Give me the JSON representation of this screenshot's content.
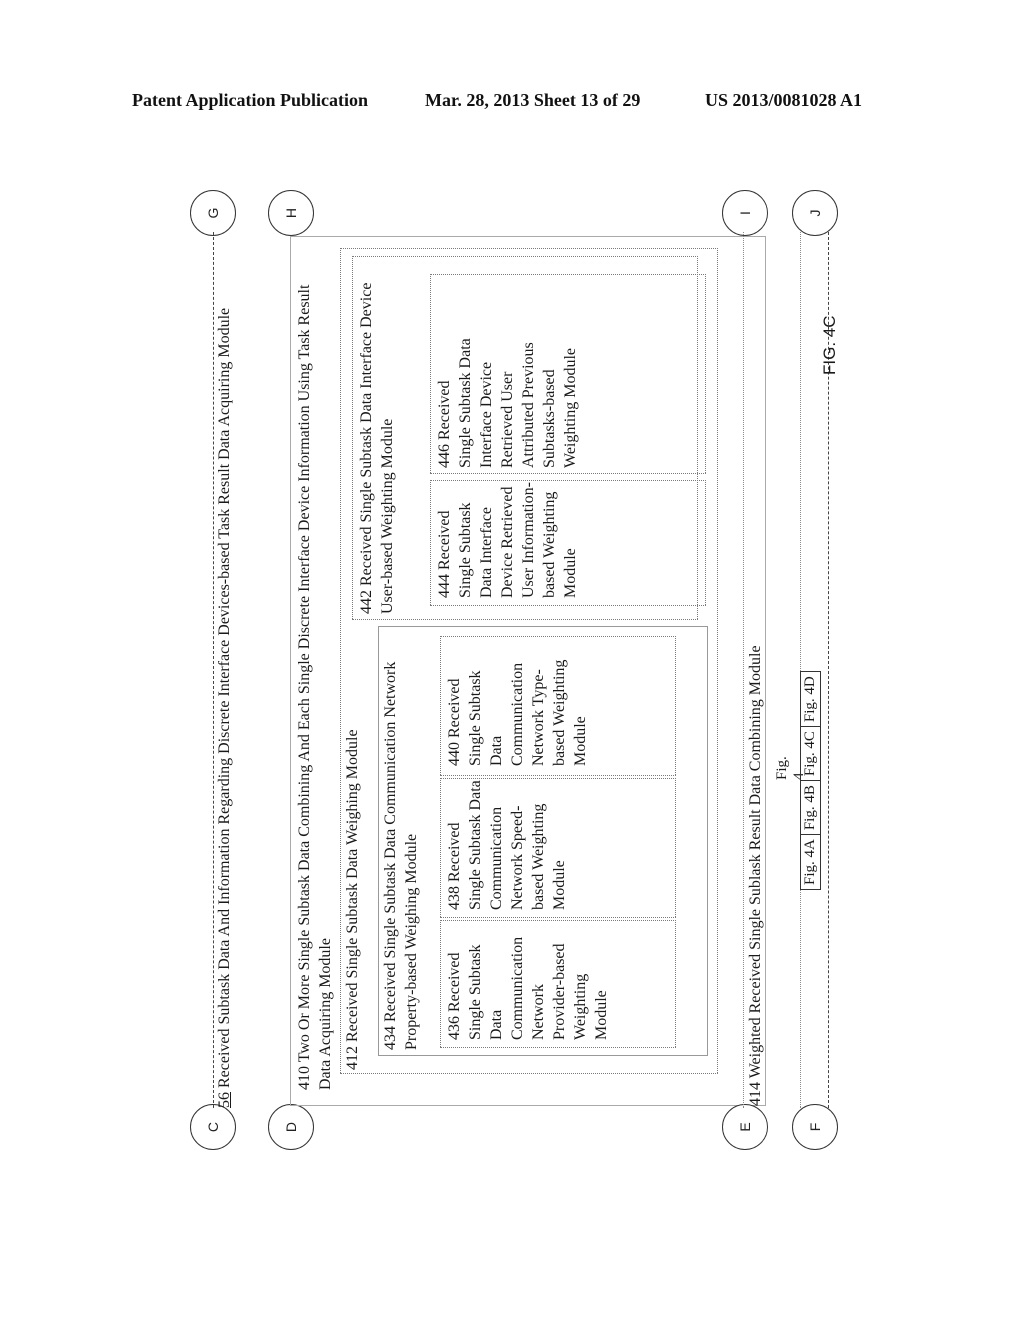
{
  "header": {
    "publication": "Patent Application Publication",
    "date_sheet": "Mar. 28, 2013  Sheet 13 of 29",
    "patent_number": "US 2013/0081028 A1"
  },
  "connectors": {
    "top_left": "C",
    "top_right": "G",
    "second_left": "D",
    "second_right": "H",
    "bottom_left_1": "E",
    "bottom_right_1": "I",
    "bottom_left_2": "F",
    "bottom_right_2": "J"
  },
  "modules": {
    "m56": {
      "ref": "56",
      "text": " Received Subtask Data And Information Regarding Discrete Interface Devices-based Task Result Data Acquiring Module"
    },
    "m410": {
      "text": "410 Two Or More Single Subtask Data Combining And Each Single Discrete Interface Device Information Using Task Result Data Acquiring Module"
    },
    "m412": {
      "text": "412 Received Single Subtask Data Weighing Module"
    },
    "m434": {
      "text": "434 Received Single Subtask Data Communication Network Property-based Weighing Module"
    },
    "m436": {
      "text": "436 Received Single Subtask Data Communication Network Provider-based Weighting Module"
    },
    "m438": {
      "text": "438 Received Single Subtask Data Communication Network Speed-based Weighting Module"
    },
    "m440": {
      "text": "440 Received Single Subtask Data Communication Network Type-based Weighting Module"
    },
    "m442": {
      "text": "442 Received Single Subtask Data Interface Device User-based Weighting Module"
    },
    "m444": {
      "text": "444 Received Single Subtask Data Interface Device Retrieved User Information-based Weighting Module"
    },
    "m446": {
      "text": "446 Received Single Subtask Data Interface Device Retrieved User Attributed Previous Subtasks-based Weighting Module"
    },
    "m414": {
      "text": "414 Weighted Received Single Sublask Result Data Combining Module"
    }
  },
  "figure_index": {
    "caption": "Fig. 4",
    "cells": [
      "Fig. 4A",
      "Fig. 4B",
      "Fig. 4C",
      "Fig. 4D"
    ]
  },
  "figure_label": "FIG. 4C"
}
